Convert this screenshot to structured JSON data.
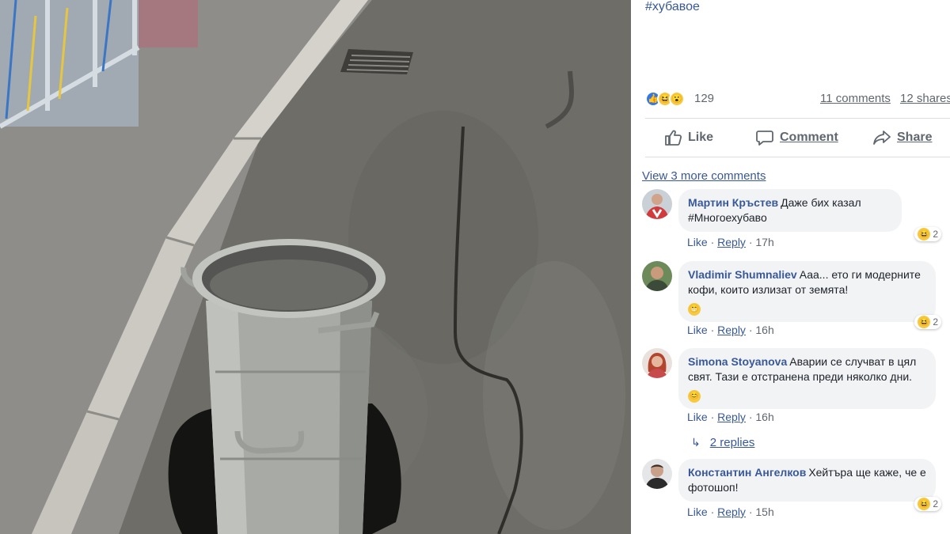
{
  "post": {
    "hashtag": "#хубавое"
  },
  "reactions": {
    "count": "129",
    "comments_label": "11 comments",
    "shares_label": "12 shares",
    "icons": [
      "like-reaction-icon",
      "haha-reaction-icon",
      "wow-reaction-icon"
    ]
  },
  "actions": {
    "like_label": "Like",
    "comment_label": "Comment",
    "share_label": "Share"
  },
  "view_more_label": "View 3 more comments",
  "comments": [
    {
      "author": "Мартин Кръстев",
      "text": "Даже бих казал #Многоехубаво",
      "like_label": "Like",
      "reply_label": "Reply",
      "time": "17h",
      "reaction_count": "2"
    },
    {
      "author": "Vladimir Shumnaliev",
      "text": "Ааа... ето ги модерните кофи, които излизат от земята!",
      "like_label": "Like",
      "reply_label": "Reply",
      "time": "16h",
      "reaction_count": "2"
    },
    {
      "author": "Simona Stoyanova",
      "text": "Аварии се случват в цял свят. Тази е отстранена преди няколко дни.",
      "like_label": "Like",
      "reply_label": "Reply",
      "time": "16h",
      "reaction_count": ""
    },
    {
      "author": "Константин Ангелков",
      "text": "Хейтъра ще каже, че е фотошоп!",
      "like_label": "Like",
      "reply_label": "Reply",
      "time": "15h",
      "reaction_count": "2"
    }
  ],
  "replies_label": "2 replies",
  "colors": {
    "link": "#385898",
    "muted": "#606770",
    "bubble": "#f2f3f5",
    "like_blue": "#3578e5",
    "emoji_yellow": "#f7c940"
  }
}
